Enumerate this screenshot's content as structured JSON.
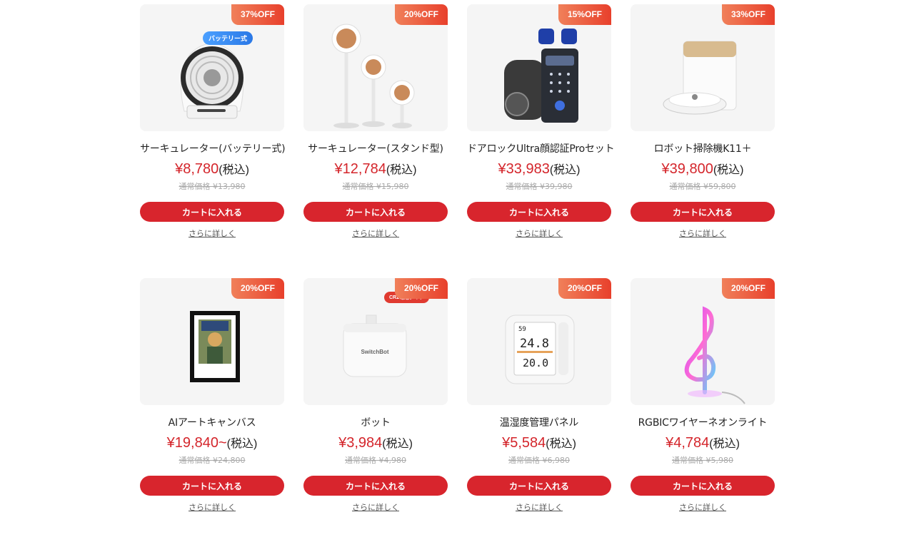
{
  "products": [
    {
      "discount": "37%OFF",
      "tag": "バッテリー式",
      "name": "サーキュレーター(バッテリー式)",
      "price": "¥8,780",
      "tax": "(税込)",
      "regular": "通常価格 ¥13,980",
      "cart": "カートに入れる",
      "more": "さらに詳しく",
      "image": "battery-circulator-fan-image"
    },
    {
      "discount": "20%OFF",
      "tag": "",
      "name": "サーキュレーター(スタンド型)",
      "price": "¥12,784",
      "tax": "(税込)",
      "regular": "通常価格 ¥15,980",
      "cart": "カートに入れる",
      "more": "さらに詳しく",
      "image": "stand-circulator-fan-image"
    },
    {
      "discount": "15%OFF",
      "tag": "",
      "name": "ドアロックUltra顔認証Proセット",
      "price": "¥33,983",
      "tax": "(税込)",
      "regular": "通常価格 ¥39,980",
      "cart": "カートに入れる",
      "more": "さらに詳しく",
      "image": "door-lock-keypad-image"
    },
    {
      "discount": "33%OFF",
      "tag": "",
      "name": "ロボット掃除機K11＋",
      "price": "¥39,800",
      "tax": "(税込)",
      "regular": "通常価格 ¥59,800",
      "cart": "カートに入れる",
      "more": "さらに詳しく",
      "image": "robot-vacuum-dock-image"
    },
    {
      "discount": "20%OFF",
      "tag": "",
      "name": "AIアートキャンバス",
      "price": "¥19,840~",
      "tax": "(税込)",
      "regular": "通常価格 ¥24,800",
      "cart": "カートに入れる",
      "more": "さらに詳しく",
      "image": "art-canvas-frame-image"
    },
    {
      "discount": "20%OFF",
      "tag": "CR2電池タイプ",
      "name": "ボット",
      "price": "¥3,984",
      "tax": "(税込)",
      "regular": "通常価格 ¥4,980",
      "cart": "カートに入れる",
      "more": "さらに詳しく",
      "image": "switchbot-bot-image",
      "image_text": "SwitchBot"
    },
    {
      "discount": "20%OFF",
      "tag": "",
      "name": "温湿度管理パネル",
      "price": "¥5,584",
      "tax": "(税込)",
      "regular": "通常価格 ¥6,980",
      "cart": "カートに入れる",
      "more": "さらに詳しく",
      "image": "thermo-panel-image",
      "readouts": [
        "59",
        "24.8",
        "20.0"
      ]
    },
    {
      "discount": "20%OFF",
      "tag": "",
      "name": "RGBICワイヤーネオンライト",
      "price": "¥4,784",
      "tax": "(税込)",
      "regular": "通常価格 ¥5,980",
      "cart": "カートに入れる",
      "more": "さらに詳しく",
      "image": "neon-treble-clef-light-image"
    }
  ],
  "colors": {
    "accent": "#d8252d",
    "price": "#d4252b",
    "badge": "#e8402c"
  }
}
